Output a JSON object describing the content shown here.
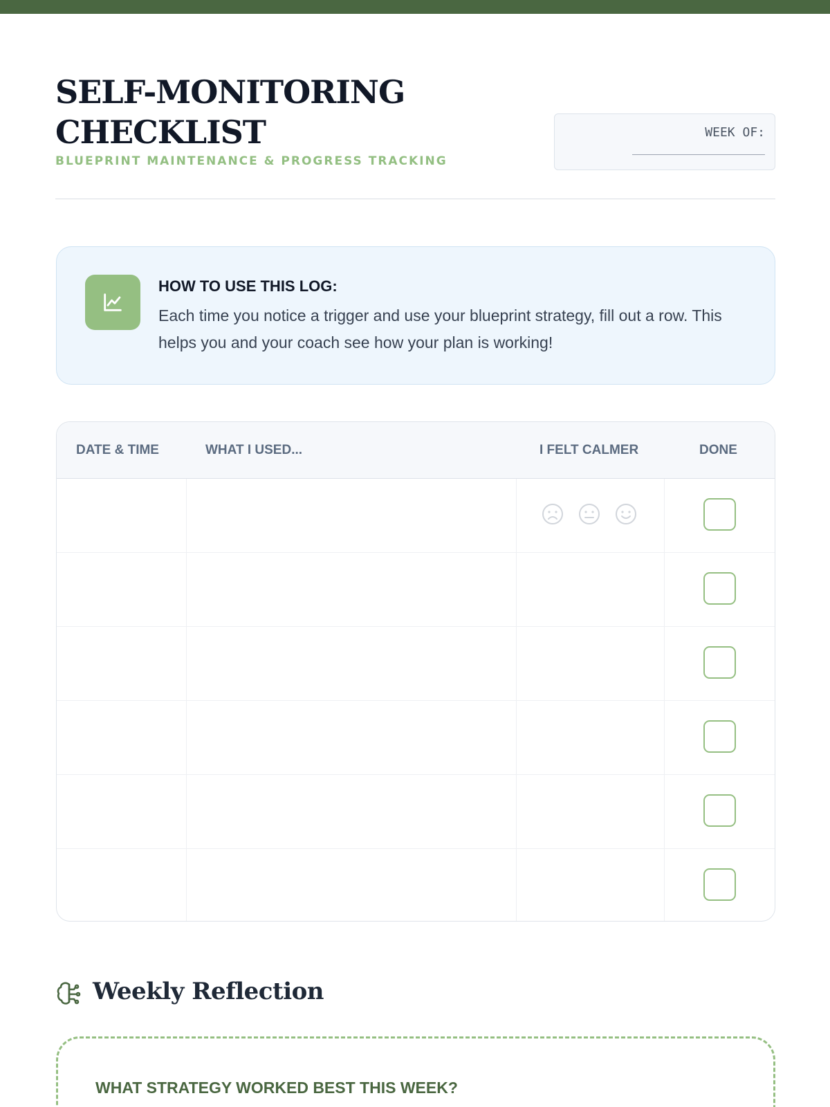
{
  "header": {
    "title": "SELF-MONITORING CHECKLIST",
    "subtitle": "BLUEPRINT MAINTENANCE & PROGRESS TRACKING",
    "week_label": "WEEK OF:"
  },
  "info": {
    "icon": "chart-line-icon",
    "title": "HOW TO USE THIS LOG:",
    "text": "Each time you notice a trigger and use your blueprint strategy, fill out a row. This helps you and your coach see how your plan is working!"
  },
  "table": {
    "columns": [
      "DATE & TIME",
      "WHAT I USED...",
      "I FELT CALMER",
      "DONE"
    ],
    "row_count": 6,
    "rating_icons": [
      "sad-face-icon",
      "neutral-face-icon",
      "happy-face-icon"
    ]
  },
  "reflection": {
    "icon": "brain-icon",
    "title": "Weekly Reflection",
    "question": "WHAT STRATEGY WORKED BEST THIS WEEK?"
  },
  "colors": {
    "accent_dark": "#4a6741",
    "accent_light": "#95bf82",
    "info_bg": "#eef6fd"
  }
}
